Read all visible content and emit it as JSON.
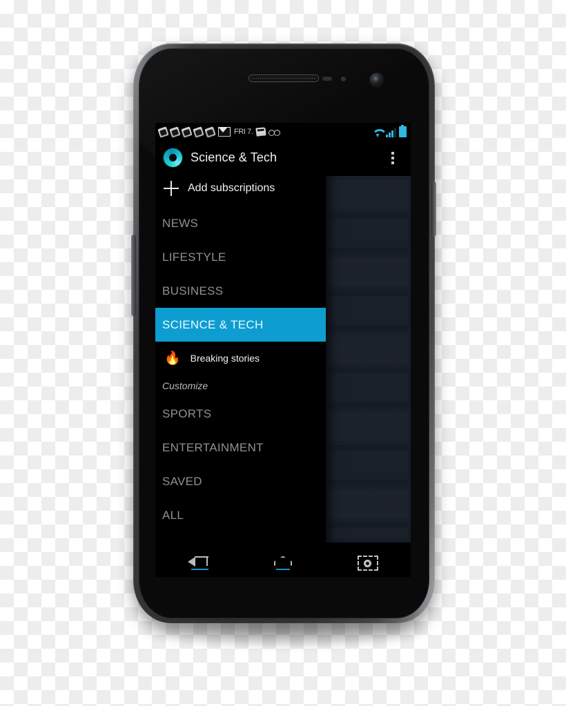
{
  "device": {
    "name": "Android smartphone (Galaxy Nexus style)",
    "hardware": {
      "earpiece": "earpiece-speaker",
      "proximity_sensor": "proximity-sensor",
      "light_sensor": "light-sensor",
      "front_camera": "front-camera",
      "volume_button": "volume-rocker",
      "power_button": "power-button"
    }
  },
  "status_bar": {
    "notification_icons": [
      "notification-card-icon",
      "notification-card-icon",
      "notification-card-icon",
      "notification-card-icon",
      "notification-card-icon",
      "gmail-icon"
    ],
    "text": "FRI 7. ",
    "extra_icons": [
      "card-icon",
      "glasses-icon"
    ],
    "right_icons": [
      "wifi-icon",
      "cellular-signal-icon",
      "battery-icon"
    ],
    "accent_color": "#2fb8e0"
  },
  "app": {
    "logo": "circular-ring-logo",
    "title": "Science & Tech",
    "overflow_label": "more-options",
    "accent_color": "#0d9dd1",
    "background_color": "#000000",
    "content_panel_color": "#161c26"
  },
  "drawer": {
    "add_subscriptions": {
      "icon": "plus-icon",
      "label": "Add subscriptions"
    },
    "categories": [
      {
        "label": "NEWS",
        "selected": false
      },
      {
        "label": "LIFESTYLE",
        "selected": false
      },
      {
        "label": "BUSINESS",
        "selected": false
      },
      {
        "label": "SCIENCE & TECH",
        "selected": true
      }
    ],
    "sub_items": [
      {
        "icon": "flame-icon",
        "glyph": "🔥",
        "label": "Breaking stories"
      }
    ],
    "customize_label": "Customize",
    "categories_after": [
      {
        "label": "SPORTS",
        "selected": false
      },
      {
        "label": "ENTERTAINMENT",
        "selected": false
      },
      {
        "label": "SAVED",
        "selected": false
      },
      {
        "label": "ALL",
        "selected": false
      }
    ]
  },
  "nav_bar": {
    "buttons": [
      {
        "name": "back-button",
        "icon": "back-arrow-icon"
      },
      {
        "name": "home-button",
        "icon": "home-icon"
      },
      {
        "name": "screenshot-button",
        "icon": "camera-screenshot-icon"
      }
    ]
  }
}
